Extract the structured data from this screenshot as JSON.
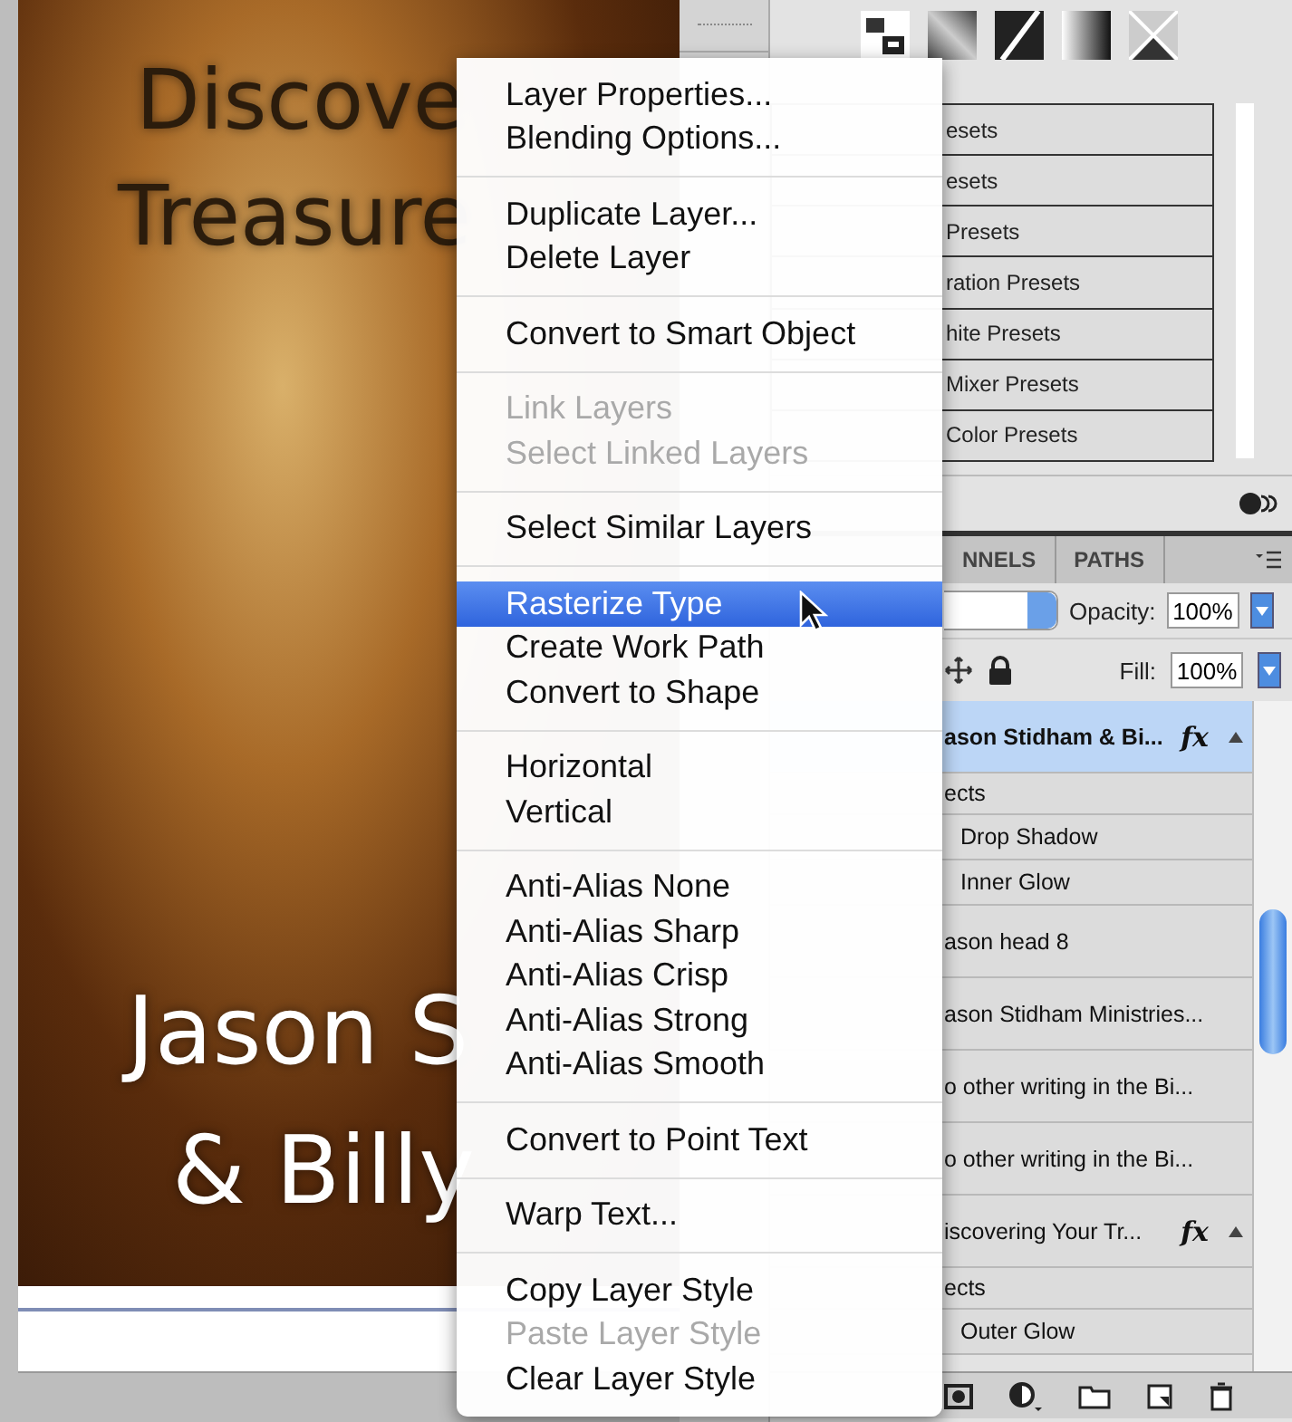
{
  "canvas": {
    "lines": [
      "Discove",
      "Treasure",
      "Jason S",
      "& Billy"
    ]
  },
  "presets_panel": {
    "items": [
      "esets",
      "esets",
      "Presets",
      "ration Presets",
      "hite Presets",
      "Mixer Presets",
      "Color Presets"
    ]
  },
  "layers_panel": {
    "tabs": [
      {
        "label": "NNELS",
        "selected": false
      },
      {
        "label": "PATHS",
        "selected": false
      }
    ],
    "opacity_label": "Opacity:",
    "opacity": "100%",
    "fill_label": "Fill:",
    "fill": "100%",
    "rows": [
      {
        "kind": "layer",
        "name": "ason Stidham  & Bi...",
        "badge": "fx",
        "expanded": true,
        "selected": true
      },
      {
        "kind": "effects",
        "name": "ects"
      },
      {
        "kind": "effect",
        "name": "Drop Shadow"
      },
      {
        "kind": "effect",
        "name": "Inner Glow"
      },
      {
        "kind": "layer",
        "name": "ason head 8",
        "selected": false
      },
      {
        "kind": "layer",
        "name": "ason Stidham  Ministries...",
        "selected": false
      },
      {
        "kind": "layer",
        "name": "o other writing in the Bi...",
        "selected": false
      },
      {
        "kind": "layer",
        "name": "o other writing in the Bi...",
        "selected": false
      },
      {
        "kind": "layer",
        "name": "iscovering Your Tr...",
        "badge": "fx",
        "expanded": true,
        "selected": false
      },
      {
        "kind": "effects",
        "name": "ects"
      },
      {
        "kind": "effect",
        "name": "Outer Glow"
      }
    ]
  },
  "context_menu": {
    "groups": [
      [
        {
          "label": "Layer Properties...",
          "disabled": false,
          "selected": false
        },
        {
          "label": "Blending Options...",
          "disabled": false,
          "selected": false
        }
      ],
      [
        {
          "label": "Duplicate Layer...",
          "disabled": false,
          "selected": false
        },
        {
          "label": "Delete Layer",
          "disabled": false,
          "selected": false
        }
      ],
      [
        {
          "label": "Convert to Smart Object",
          "disabled": false,
          "selected": false
        }
      ],
      [
        {
          "label": "Link Layers",
          "disabled": true,
          "selected": false
        },
        {
          "label": "Select Linked Layers",
          "disabled": true,
          "selected": false
        }
      ],
      [
        {
          "label": "Select Similar Layers",
          "disabled": false,
          "selected": false
        }
      ],
      [
        {
          "label": "Rasterize Type",
          "disabled": false,
          "selected": true
        },
        {
          "label": "Create Work Path",
          "disabled": false,
          "selected": false
        },
        {
          "label": "Convert to Shape",
          "disabled": false,
          "selected": false
        }
      ],
      [
        {
          "label": "Horizontal",
          "disabled": false,
          "selected": false
        },
        {
          "label": "Vertical",
          "disabled": false,
          "selected": false
        }
      ],
      [
        {
          "label": "Anti-Alias None",
          "disabled": false,
          "selected": false
        },
        {
          "label": "Anti-Alias Sharp",
          "disabled": false,
          "selected": false
        },
        {
          "label": "Anti-Alias Crisp",
          "disabled": false,
          "selected": false
        },
        {
          "label": "Anti-Alias Strong",
          "disabled": false,
          "selected": false
        },
        {
          "label": "Anti-Alias Smooth",
          "disabled": false,
          "selected": false
        }
      ],
      [
        {
          "label": "Convert to Point Text",
          "disabled": false,
          "selected": false
        }
      ],
      [
        {
          "label": "Warp Text...",
          "disabled": false,
          "selected": false
        }
      ],
      [
        {
          "label": "Copy Layer Style",
          "disabled": false,
          "selected": false
        },
        {
          "label": "Paste Layer Style",
          "disabled": true,
          "selected": false
        },
        {
          "label": "Clear Layer Style",
          "disabled": false,
          "selected": false
        }
      ]
    ]
  }
}
